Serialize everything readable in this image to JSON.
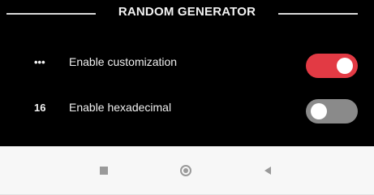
{
  "header": {
    "title": "RANDOM GENERATOR"
  },
  "settings": [
    {
      "icon_text": "•••",
      "label": "Enable customization",
      "enabled": true
    },
    {
      "icon_text": "16",
      "label": "Enable hexadecimal",
      "enabled": false
    }
  ],
  "colors": {
    "background": "#000000",
    "toggle_on": "#e23a44",
    "toggle_off": "#8a8a8a",
    "nav_background": "#f7f7f7"
  },
  "icons": {
    "recents": "square-icon",
    "home": "circle-home-icon",
    "back": "triangle-back-icon"
  }
}
